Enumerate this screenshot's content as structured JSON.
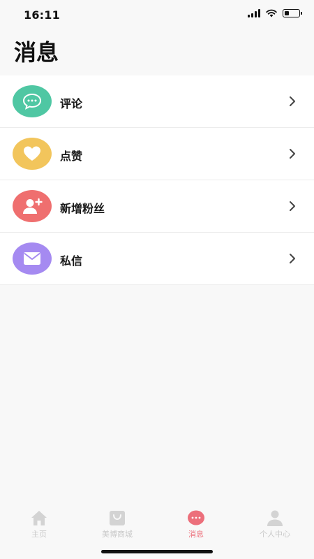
{
  "status_bar": {
    "time": "16:11",
    "battery_level": 0.35
  },
  "page": {
    "title": "消息"
  },
  "list": {
    "items": [
      {
        "label": "评论",
        "icon": "chat-bubble-icon",
        "color": "#4fc7a3"
      },
      {
        "label": "点赞",
        "icon": "heart-icon",
        "color": "#f2c55c"
      },
      {
        "label": "新增粉丝",
        "icon": "add-user-icon",
        "color": "#ef6f6f"
      },
      {
        "label": "私信",
        "icon": "mail-icon",
        "color": "#a58af1"
      }
    ]
  },
  "tab_bar": {
    "tabs": [
      {
        "label": "主页",
        "icon": "home-icon",
        "active": false
      },
      {
        "label": "美博商城",
        "icon": "shopping-bag-icon",
        "active": false
      },
      {
        "label": "消息",
        "icon": "message-icon",
        "active": true
      },
      {
        "label": "个人中心",
        "icon": "user-icon",
        "active": false
      }
    ],
    "active_color": "#ec6f7b",
    "inactive_color": "#c9c9c9"
  }
}
